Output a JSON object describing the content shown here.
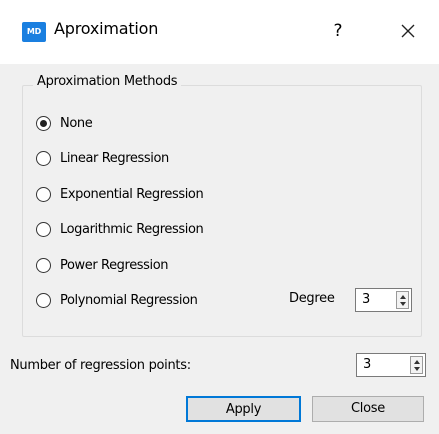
{
  "window": {
    "app_icon_text": "MD",
    "title": "Aproximation",
    "help_label": "?"
  },
  "group": {
    "title": "Aproximation Methods",
    "options": [
      {
        "label": "None",
        "checked": true
      },
      {
        "label": "Linear Regression",
        "checked": false
      },
      {
        "label": "Exponential Regression",
        "checked": false
      },
      {
        "label": "Logarithmic Regression",
        "checked": false
      },
      {
        "label": "Power Regression",
        "checked": false
      },
      {
        "label": "Polynomial Regression",
        "checked": false
      }
    ],
    "degree_label": "Degree",
    "degree_value": "3"
  },
  "points": {
    "label": "Number of regression points:",
    "value": "3"
  },
  "buttons": {
    "apply": "Apply",
    "close": "Close"
  },
  "colors": {
    "accent": "#0078d7",
    "app_icon": "#1a7fe0",
    "window_bg": "#f0f0f0",
    "titlebar_bg": "#ffffff"
  }
}
